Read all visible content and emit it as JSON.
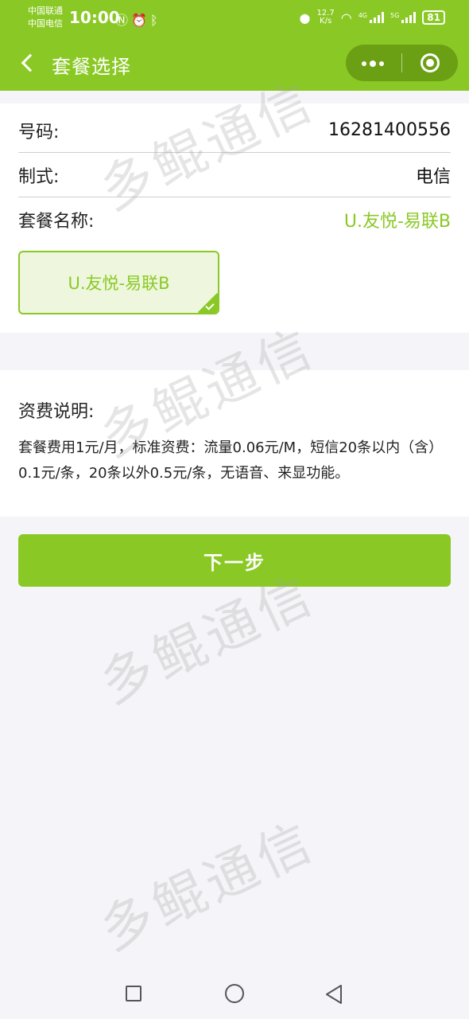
{
  "status_bar": {
    "carrier_1": "中国联通",
    "carrier_2": "中国电信",
    "time": "10:00",
    "speed_value": "12.7",
    "speed_unit": "K/s",
    "sig1_label": "4G",
    "sig2_label": "5G",
    "battery": "81"
  },
  "header": {
    "title": "套餐选择"
  },
  "info": {
    "number_label": "号码:",
    "number_value": "16281400556",
    "type_label": "制式:",
    "type_value": "电信",
    "plan_label": "套餐名称:",
    "plan_value": "U.友悦-易联B"
  },
  "plan_options": [
    {
      "label": "U.友悦-易联B",
      "selected": true
    }
  ],
  "fee": {
    "title": "资费说明:",
    "description": "套餐费用1元/月，标准资费：流量0.06元/M，短信20条以内（含）0.1元/条，20条以外0.5元/条，无语音、来显功能。"
  },
  "actions": {
    "next_label": "下一步"
  },
  "watermark": "多鲲通信",
  "colors": {
    "accent": "#8ac925",
    "selected_bg": "#eef7dd",
    "page_bg": "#f5f5f9"
  }
}
